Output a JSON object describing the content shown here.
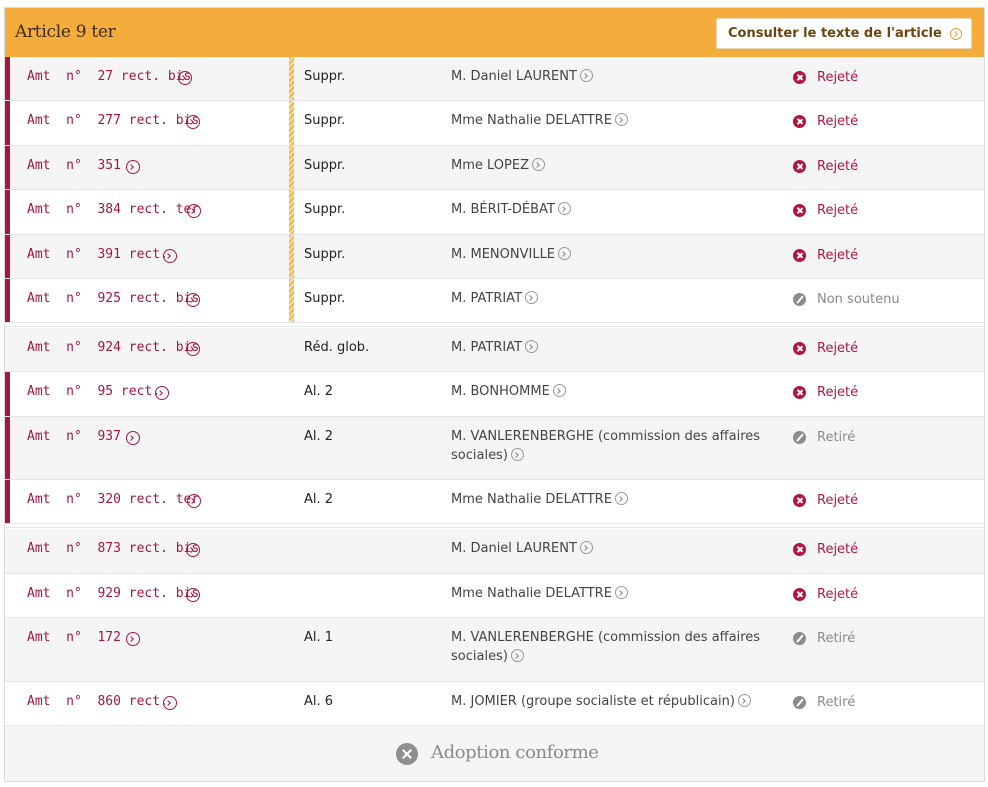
{
  "header": {
    "title": "Article 9 ter",
    "consult_label": "Consulter le texte de l'article"
  },
  "rows": [
    {
      "amt": "Amt  n°  27 rect. bis",
      "place": "Suppr.",
      "author": "M. Daniel LAURENT",
      "status": "Rejeté",
      "status_type": "rejete"
    },
    {
      "amt": "Amt  n°  277 rect. bis",
      "place": "Suppr.",
      "author": "Mme Nathalie DELATTRE",
      "status": "Rejeté",
      "status_type": "rejete"
    },
    {
      "amt": "Amt  n°  351",
      "place": "Suppr.",
      "author": "Mme LOPEZ",
      "status": "Rejeté",
      "status_type": "rejete"
    },
    {
      "amt": "Amt  n°  384 rect. ter",
      "place": "Suppr.",
      "author": "M. BÉRIT-DÉBAT",
      "status": "Rejeté",
      "status_type": "rejete"
    },
    {
      "amt": "Amt  n°  391 rect.",
      "place": "Suppr.",
      "author": "M. MENONVILLE",
      "status": "Rejeté",
      "status_type": "rejete"
    },
    {
      "amt": "Amt  n°  925 rect. bis",
      "place": "Suppr.",
      "author": "M. PATRIAT",
      "status": "Non soutenu",
      "status_type": "neutral"
    },
    {
      "amt": "Amt  n°  924 rect. bis",
      "place": "Réd. glob.",
      "author": "M. PATRIAT",
      "status": "Rejeté",
      "status_type": "rejete"
    },
    {
      "amt": "Amt  n°  95 rect.",
      "place": "Al. 2",
      "author": "M. BONHOMME",
      "status": "Rejeté",
      "status_type": "rejete"
    },
    {
      "amt": "Amt  n°  937",
      "place": "Al. 2",
      "author": "M. VANLERENBERGHE  (commission des affaires sociales)",
      "status": "Retiré",
      "status_type": "neutral"
    },
    {
      "amt": "Amt  n°  320 rect. ter",
      "place": "Al. 2",
      "author": "Mme Nathalie DELATTRE",
      "status": "Rejeté",
      "status_type": "rejete"
    },
    {
      "amt": "Amt  n°  873 rect. bis",
      "place": "",
      "author": "M. Daniel LAURENT",
      "status": "Rejeté",
      "status_type": "rejete"
    },
    {
      "amt": "Amt  n°  929 rect. bis",
      "place": "",
      "author": "Mme Nathalie DELATTRE",
      "status": "Rejeté",
      "status_type": "rejete"
    },
    {
      "amt": "Amt  n°  172",
      "place": "Al. 1",
      "author": "M. VANLERENBERGHE  (commission des affaires sociales)",
      "status": "Retiré",
      "status_type": "neutral"
    },
    {
      "amt": "Amt  n°  860 rect.",
      "place": "Al. 6",
      "author": "M. JOMIER  (groupe socialiste et républicain)",
      "status": "Retiré",
      "status_type": "neutral"
    }
  ],
  "footer": {
    "result": "Adoption conforme"
  },
  "colors": {
    "header_bg": "#f4ac3c",
    "accent_red": "#a4173f",
    "neutral_gray": "#8c8c8c"
  }
}
